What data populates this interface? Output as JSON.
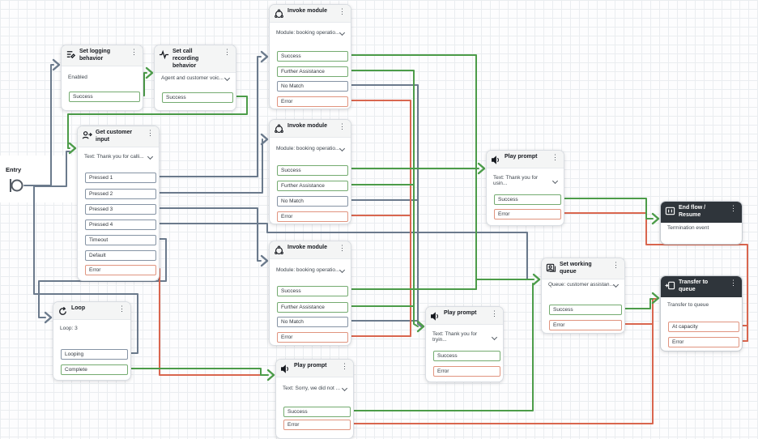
{
  "entry": {
    "label": "Entry"
  },
  "menu_icon": "⋮",
  "colors": {
    "success": "#4c9c49",
    "neutral": "#6b7a8c",
    "error": "#d9664f",
    "dark_header": "#2f353b"
  },
  "nodes": {
    "set_logging": {
      "title": "Set logging behavior",
      "body": "Enabled",
      "outputs": [
        {
          "label": "Success",
          "kind": "success"
        }
      ]
    },
    "set_call_recording": {
      "title": "Set call recording behavior",
      "dropdown": "Agent and customer voic...",
      "outputs": [
        {
          "label": "Success",
          "kind": "success"
        }
      ]
    },
    "invoke_module_1": {
      "title": "Invoke module",
      "dropdown": "Module: booking operatio...",
      "outputs": [
        {
          "label": "Success",
          "kind": "success"
        },
        {
          "label": "Further Assistance",
          "kind": "success"
        },
        {
          "label": "No Match",
          "kind": "neutral"
        },
        {
          "label": "Error",
          "kind": "error"
        }
      ]
    },
    "invoke_module_2": {
      "title": "Invoke module",
      "dropdown": "Module: booking operatio...",
      "outputs": [
        {
          "label": "Success",
          "kind": "success"
        },
        {
          "label": "Further Assistance",
          "kind": "success"
        },
        {
          "label": "No Match",
          "kind": "neutral"
        },
        {
          "label": "Error",
          "kind": "error"
        }
      ]
    },
    "invoke_module_3": {
      "title": "Invoke module",
      "dropdown": "Module: booking operatio...",
      "outputs": [
        {
          "label": "Success",
          "kind": "success"
        },
        {
          "label": "Further Assistance",
          "kind": "success"
        },
        {
          "label": "No Match",
          "kind": "neutral"
        },
        {
          "label": "Error",
          "kind": "error"
        }
      ]
    },
    "get_customer_input": {
      "title": "Get customer input",
      "dropdown": "Text: Thank you for calli...",
      "outputs": [
        {
          "label": "Pressed 1",
          "kind": "neutral"
        },
        {
          "label": "Pressed 2",
          "kind": "neutral"
        },
        {
          "label": "Pressed 3",
          "kind": "neutral"
        },
        {
          "label": "Pressed 4",
          "kind": "neutral"
        },
        {
          "label": "Timeout",
          "kind": "neutral"
        },
        {
          "label": "Default",
          "kind": "neutral"
        },
        {
          "label": "Error",
          "kind": "error"
        }
      ]
    },
    "loop": {
      "title": "Loop",
      "body": "Loop: 3",
      "outputs": [
        {
          "label": "Looping",
          "kind": "neutral"
        },
        {
          "label": "Complete",
          "kind": "success"
        }
      ]
    },
    "play_prompt_using": {
      "title": "Play prompt",
      "dropdown": "Text: Thank you for usin...",
      "outputs": [
        {
          "label": "Success",
          "kind": "success"
        },
        {
          "label": "Error",
          "kind": "error"
        }
      ]
    },
    "play_prompt_trying": {
      "title": "Play prompt",
      "dropdown": "Text: Thank you for tryin...",
      "outputs": [
        {
          "label": "Success",
          "kind": "success"
        },
        {
          "label": "Error",
          "kind": "error"
        }
      ]
    },
    "play_prompt_sorry": {
      "title": "Play prompt",
      "dropdown": "Text: Sorry, we did not ...",
      "outputs": [
        {
          "label": "Success",
          "kind": "success"
        },
        {
          "label": "Error",
          "kind": "error"
        }
      ]
    },
    "set_working_queue": {
      "title": "Set working queue",
      "dropdown": "Queue: customer assistan...",
      "outputs": [
        {
          "label": "Success",
          "kind": "success"
        },
        {
          "label": "Error",
          "kind": "error"
        }
      ]
    },
    "end_flow": {
      "title": "End flow / Resume",
      "body": "Termination event",
      "outputs": []
    },
    "transfer_to_queue": {
      "title": "Transfer to queue",
      "body": "Transfer to queue",
      "outputs": [
        {
          "label": "At capacity",
          "kind": "error"
        },
        {
          "label": "Error",
          "kind": "error"
        }
      ]
    }
  }
}
